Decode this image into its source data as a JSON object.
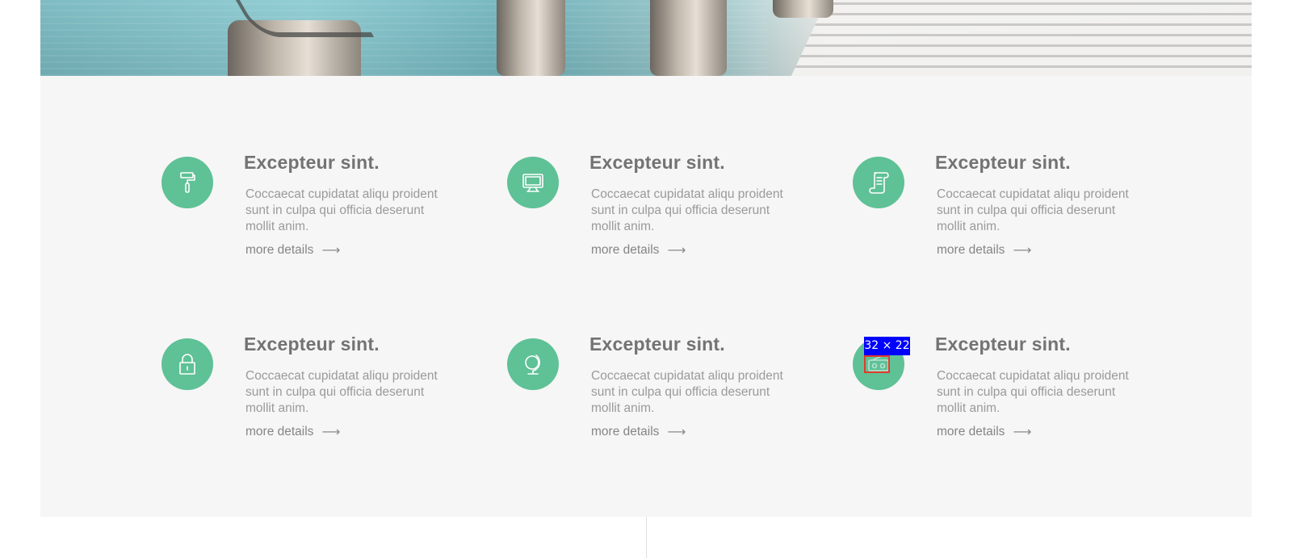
{
  "hero": {
    "image_description": ""
  },
  "features": [
    {
      "icon": "paint-roller-icon",
      "title": "Excepteur sint.",
      "description": "Coccaecat cupidatat aliqu proident sunt in culpa qui officia deserunt mollit anim.",
      "link": "more details",
      "arrow": "⟶"
    },
    {
      "icon": "monitor-icon",
      "title": "Excepteur sint.",
      "description": "Coccaecat cupidatat aliqu proident sunt in culpa qui officia deserunt mollit anim.",
      "link": "more details",
      "arrow": "⟶"
    },
    {
      "icon": "scroll-document-icon",
      "title": "Excepteur sint.",
      "description": "Coccaecat cupidatat aliqu proident sunt in culpa qui officia deserunt mollit anim.",
      "link": "more details",
      "arrow": "⟶"
    },
    {
      "icon": "padlock-icon",
      "title": "Excepteur sint.",
      "description": "Coccaecat cupidatat aliqu proident sunt in culpa qui officia deserunt mollit anim.",
      "link": "more details",
      "arrow": "⟶"
    },
    {
      "icon": "globe-icon",
      "title": "Excepteur sint.",
      "description": "Coccaecat cupidatat aliqu proident sunt in culpa qui officia deserunt mollit anim.",
      "link": "more details",
      "arrow": "⟶"
    },
    {
      "icon": "radio-icon",
      "title": "Excepteur sint.",
      "description": "Coccaecat cupidatat aliqu proident sunt in culpa qui officia deserunt mollit anim.",
      "link": "more details",
      "arrow": "⟶"
    }
  ],
  "overlay": {
    "dimension_label": "32 × 22"
  },
  "colors": {
    "accent": "#5fc196",
    "section_bg": "#f6f6f6",
    "title": "#737373",
    "body_text": "#9a9a9a",
    "overlay_label_bg": "#0000ff",
    "overlay_box_border": "#e23b2b"
  }
}
